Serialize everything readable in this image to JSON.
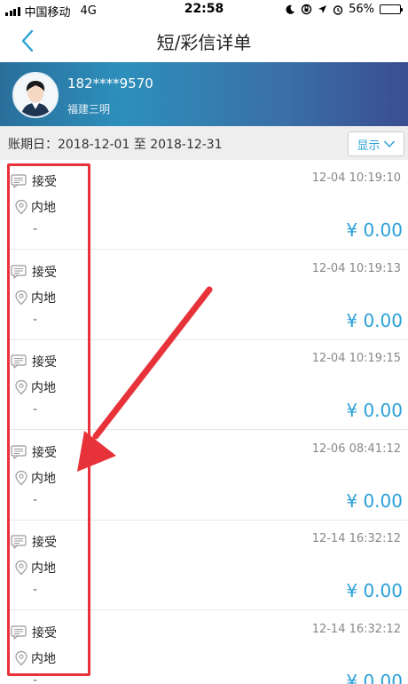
{
  "status_bar": {
    "carrier": "中国移动",
    "network": "4G",
    "time": "22:58",
    "battery_percent": "56%",
    "battery_level": 0.56
  },
  "nav": {
    "title": "短/彩信详单"
  },
  "profile": {
    "phone": "182****9570",
    "location": "福建三明"
  },
  "period": {
    "label": "账期日：2018-12-01 至 2018-12-31",
    "show_button": "显示"
  },
  "records": [
    {
      "type": "接受",
      "region": "内地",
      "note": "-",
      "time": "12-04 10:19:10",
      "amount": "¥ 0.00"
    },
    {
      "type": "接受",
      "region": "内地",
      "note": "-",
      "time": "12-04 10:19:13",
      "amount": "¥ 0.00"
    },
    {
      "type": "接受",
      "region": "内地",
      "note": "-",
      "time": "12-04 10:19:15",
      "amount": "¥ 0.00"
    },
    {
      "type": "接受",
      "region": "内地",
      "note": "-",
      "time": "12-06 08:41:12",
      "amount": "¥ 0.00"
    },
    {
      "type": "接受",
      "region": "内地",
      "note": "-",
      "time": "12-14 16:32:12",
      "amount": "¥ 0.00"
    },
    {
      "type": "接受",
      "region": "内地",
      "note": "-",
      "time": "12-14 16:32:12",
      "amount": "¥ 0.00"
    }
  ],
  "colors": {
    "accent": "#2aa0d8",
    "annotation": "#e8323a"
  }
}
